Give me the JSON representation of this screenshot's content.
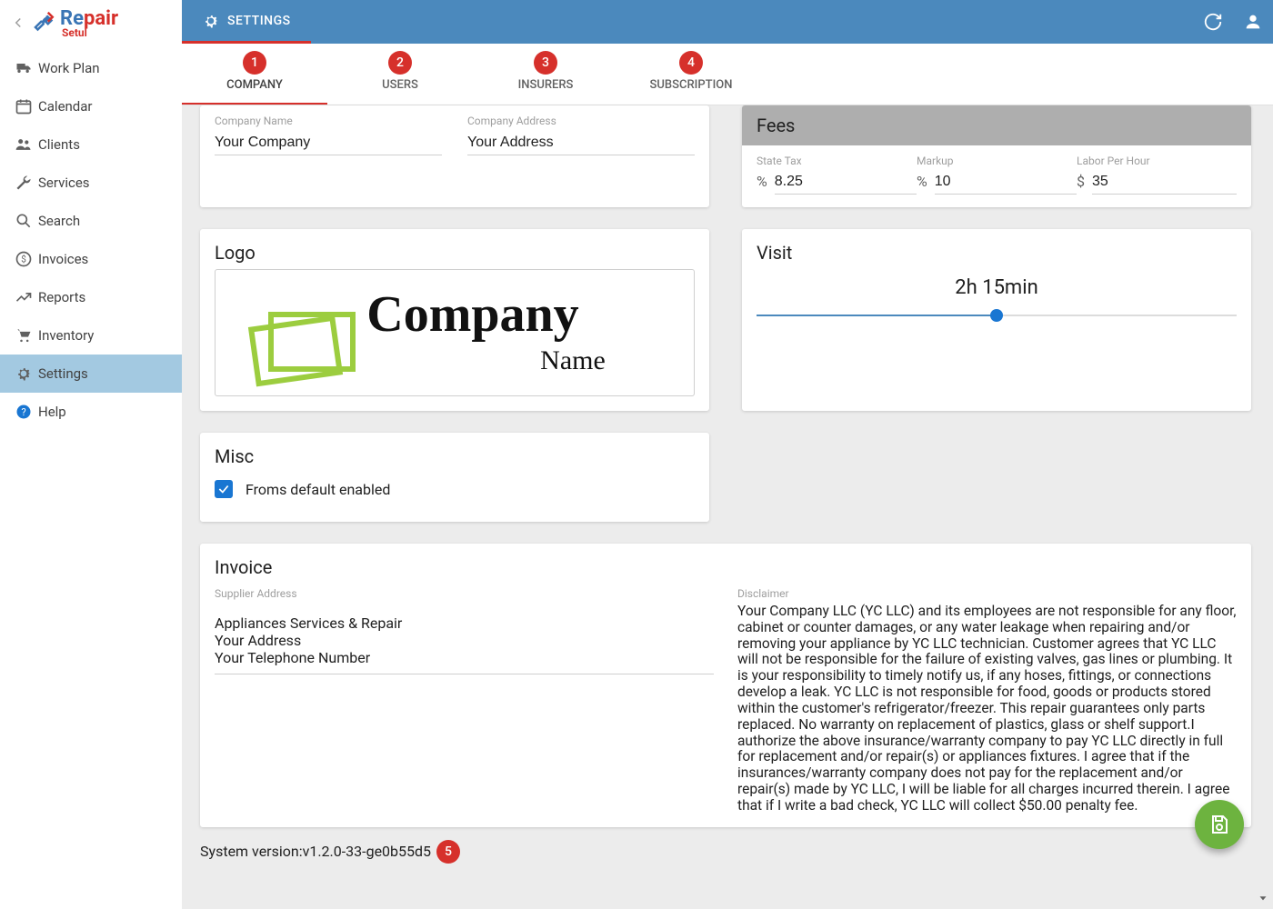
{
  "brand": {
    "name1": "Re",
    "name2": "pair",
    "sub": "Setul"
  },
  "topbar": {
    "title": "SETTINGS"
  },
  "sidebar": {
    "items": [
      {
        "label": "Work Plan"
      },
      {
        "label": "Calendar"
      },
      {
        "label": "Clients"
      },
      {
        "label": "Services"
      },
      {
        "label": "Search"
      },
      {
        "label": "Invoices"
      },
      {
        "label": "Reports"
      },
      {
        "label": "Inventory"
      },
      {
        "label": "Settings"
      },
      {
        "label": "Help"
      }
    ]
  },
  "tabs": {
    "items": [
      {
        "num": "1",
        "label": "COMPANY"
      },
      {
        "num": "2",
        "label": "USERS"
      },
      {
        "num": "3",
        "label": "INSURERS"
      },
      {
        "num": "4",
        "label": "SUBSCRIPTION"
      }
    ]
  },
  "company": {
    "name_label": "Company Name",
    "name_value": "Your Company",
    "addr_label": "Company Address",
    "addr_value": "Your Address"
  },
  "fees": {
    "title": "Fees",
    "state_tax_label": "State Tax",
    "state_tax_prefix": "%",
    "state_tax_value": "8.25",
    "markup_label": "Markup",
    "markup_prefix": "%",
    "markup_value": "10",
    "labor_label": "Labor Per Hour",
    "labor_prefix": "$",
    "labor_value": "35"
  },
  "logo": {
    "title": "Logo",
    "text_top": "Company",
    "text_sub": "Name"
  },
  "visit": {
    "title": "Visit",
    "value": "2h 15min"
  },
  "misc": {
    "title": "Misc",
    "checkbox_label": "Froms default enabled"
  },
  "invoice": {
    "title": "Invoice",
    "supplier_label": "Supplier Address",
    "supplier_value": "Appliances Services & Repair\nYour Address\nYour Telephone Number",
    "disclaimer_label": "Disclaimer",
    "disclaimer_value": "Your Company LLC (YC LLC) and its employees are not responsible for any floor, cabinet or counter damages, or any water leakage when repairing and/or removing your appliance by YC LLC technician. Customer agrees that YC LLC will not be responsible for the failure of existing valves, gas lines or plumbing. It is your responsibility to timely notify us, if any hoses, fittings, or connections develop a leak. YC LLC is not responsible for food, goods or products stored within the customer's refrigerator/freezer. This repair guarantees only parts replaced. No warranty on replacement of plastics, glass or shelf support.I authorize the above insurance/warranty company to pay YC LLC directly in full for replacement and/or repair(s) or appliances fixtures. I agree that if the insurances/warranty company does not pay for the replacement and/or repair(s) made by YC LLC, I will be liable for all charges incurred therein. I agree that if I write a bad check, YC LLC will collect $50.00 penalty fee."
  },
  "system": {
    "label": "System version: ",
    "value": "v1.2.0-33-ge0b55d5",
    "badge": "5"
  }
}
